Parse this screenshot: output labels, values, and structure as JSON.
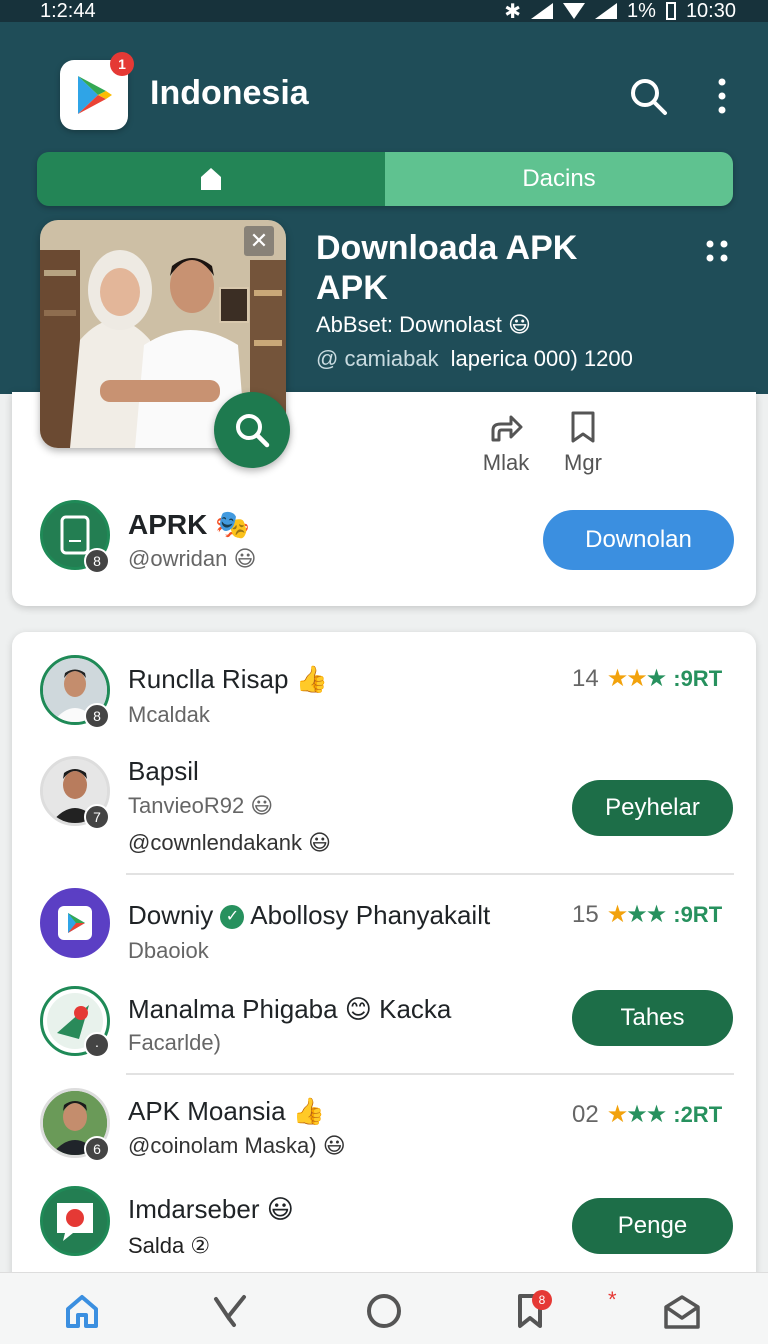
{
  "status": {
    "left_time": "1:2:44",
    "battery": "1%",
    "right_time": "10:30"
  },
  "header": {
    "title": "Indonesia",
    "notif_count": "1",
    "tab_label": "Dacins"
  },
  "featured": {
    "title_line1": "Downloada  APK",
    "title_line2": "APK",
    "subtitle": "AbBset: Downolast 😃",
    "meta_handle": "@ camiabak",
    "meta_info": "laperica 000) 1200",
    "close": "✕"
  },
  "actions": [
    {
      "label": "Mlak",
      "icon": "share-icon"
    },
    {
      "label": "Mgr",
      "icon": "bookmark-icon"
    }
  ],
  "app_row": {
    "name": "APRK 🎭",
    "handle": "@owridan 😃",
    "button": "Downolan",
    "badge": "8"
  },
  "list": [
    {
      "name": "Runclla Risap",
      "sub": "Mcaldak",
      "badge": "8",
      "rating_num": "14",
      "rating_rt": ":9RT",
      "verified": true
    },
    {
      "name": "Bapsil",
      "sub": "TanvieoR92 😃",
      "sub2": "@cownlendakank 😃",
      "badge": "7",
      "button": "Peyhelar"
    },
    {
      "name": "Downiy",
      "name_rest": "Abollosy Phanyakailt",
      "sub": "Dbaoiok",
      "rating_num": "15",
      "rating_rt": ":9RT"
    },
    {
      "name": "Manalma Phigaba 😊 Kacka",
      "sub": "Facarlde)",
      "button": "Tahes"
    },
    {
      "name": "APK Moansia",
      "sub": "@coinolam Maska) 😃",
      "badge": "6",
      "rating_num": "02",
      "rating_rt": ":2RT",
      "verified": true
    },
    {
      "name": "Imdarseber 😃",
      "sub": "Salda ②",
      "button": "Penge"
    }
  ],
  "nav": {
    "notif": "8"
  }
}
